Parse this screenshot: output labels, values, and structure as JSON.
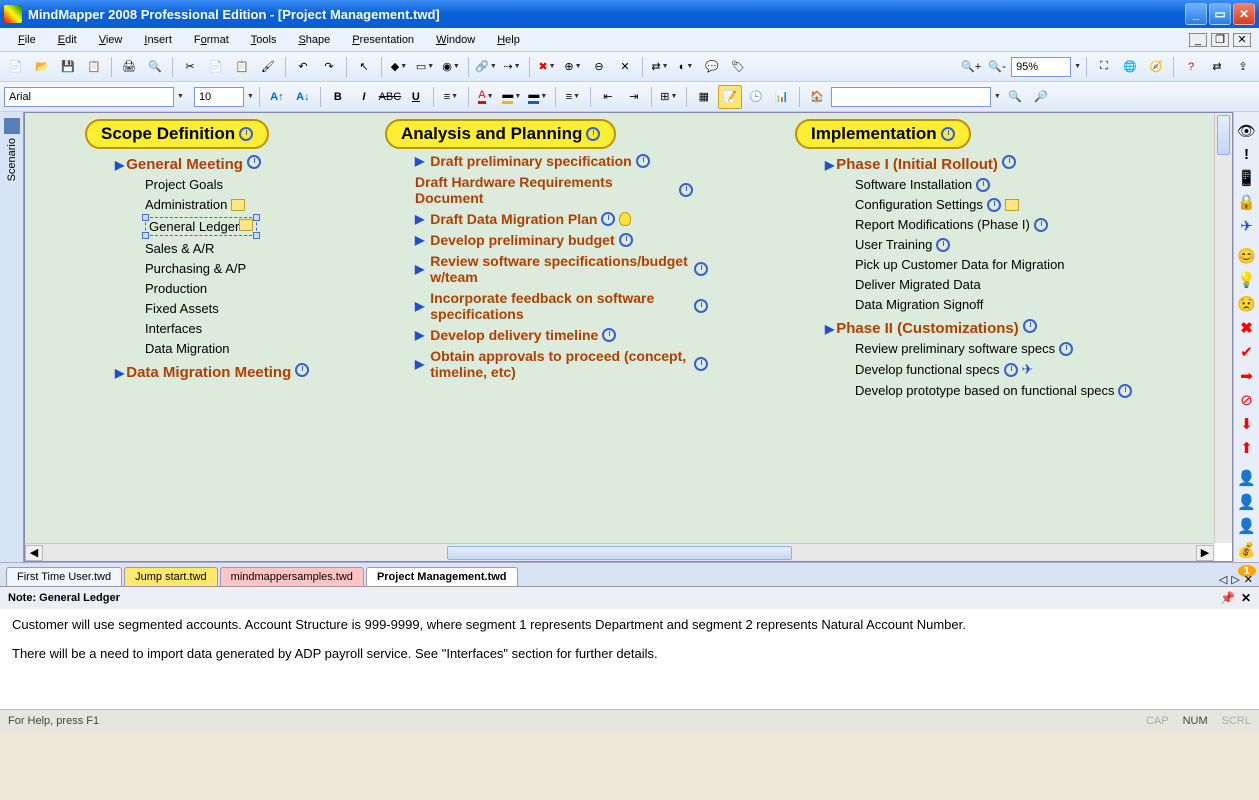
{
  "title": "MindMapper 2008 Professional Edition - [Project Management.twd]",
  "menus": [
    "File",
    "Edit",
    "View",
    "Insert",
    "Format",
    "Tools",
    "Shape",
    "Presentation",
    "Window",
    "Help"
  ],
  "zoom": "95%",
  "font_name": "Arial",
  "font_size": "10",
  "scenario_label": "Scenario",
  "columns": {
    "scope": {
      "title": "Scope Definition",
      "groups": [
        {
          "title": "General Meeting",
          "items": [
            "Project Goals",
            "Administration",
            "General Ledger",
            "Sales & A/R",
            "Purchasing & A/P",
            "Production",
            "Fixed Assets",
            "Interfaces",
            "Data Migration"
          ]
        },
        {
          "title": "Data Migration Meeting",
          "items": []
        }
      ]
    },
    "analysis": {
      "title": "Analysis and Planning",
      "items": [
        "Draft preliminary specification",
        "Draft Hardware Requirements Document",
        "Draft Data Migration Plan",
        "Develop preliminary budget",
        "Review software specifications/budget w/team",
        "Incorporate feedback on software specifications",
        "Develop delivery timeline",
        "Obtain approvals to proceed (concept, timeline, etc)"
      ]
    },
    "implementation": {
      "title": "Implementation",
      "phase1": {
        "title": "Phase I (Initial Rollout)",
        "items": [
          "Software Installation",
          "Configuration Settings",
          "Report Modifications (Phase I)",
          "User Training",
          "Pick up Customer Data for Migration",
          "Deliver Migrated Data",
          "Data Migration Signoff"
        ]
      },
      "phase2": {
        "title": "Phase II (Customizations)",
        "items": [
          "Review preliminary software specs",
          "Develop functional specs",
          "Develop prototype based on functional specs"
        ]
      }
    }
  },
  "selected_node": "General Ledger",
  "tabs": [
    "First Time User.twd",
    "Jump start.twd",
    "mindmappersamples.twd",
    "Project Management.twd"
  ],
  "active_tab": 3,
  "notes": {
    "title": "Note: General Ledger",
    "para1": "Customer will use segmented accounts.  Account Structure is 999-9999, where segment 1 represents Department and segment 2 represents Natural Account Number.",
    "para2": "There will be a need to import data generated by ADP payroll service.  See \"Interfaces\" section for further details."
  },
  "status": {
    "help": "For Help, press F1",
    "num": "NUM",
    "cap": "CAP",
    "scrl": "SCRL"
  }
}
